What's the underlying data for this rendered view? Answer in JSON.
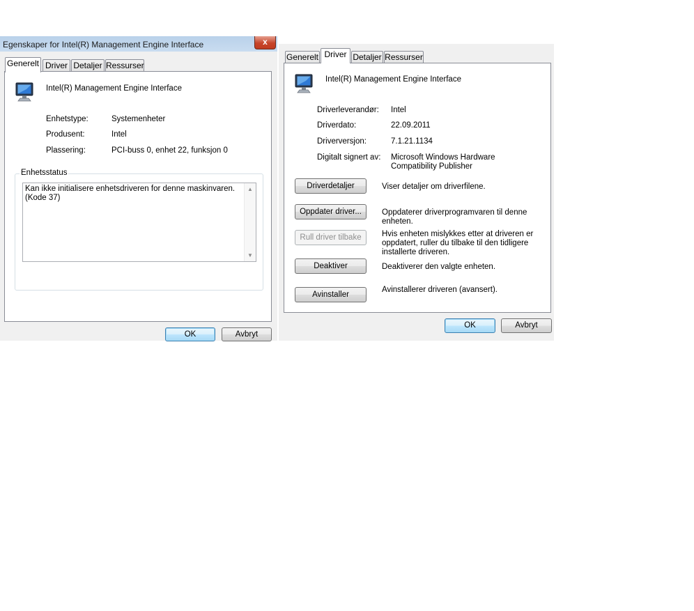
{
  "left_dialog": {
    "title": "Egenskaper for Intel(R) Management Engine Interface",
    "close_glyph": "x",
    "tabs": [
      {
        "label": "Generelt",
        "active": true
      },
      {
        "label": "Driver",
        "active": false
      },
      {
        "label": "Detaljer",
        "active": false
      },
      {
        "label": "Ressurser",
        "active": false
      }
    ],
    "device_name": "Intel(R) Management Engine Interface",
    "device_icon": "monitor-icon",
    "properties": [
      {
        "label": "Enhetstype:",
        "value": "Systemenheter"
      },
      {
        "label": "Produsent:",
        "value": "Intel"
      },
      {
        "label": "Plassering:",
        "value": "PCI-buss 0, enhet 22, funksjon 0"
      }
    ],
    "status_group": {
      "legend": "Enhetsstatus",
      "text": "Kan ikke initialisere enhetsdriveren for denne maskinvaren. (Kode 37)"
    },
    "ok_label": "OK",
    "cancel_label": "Avbryt"
  },
  "right_dialog": {
    "tabs": [
      {
        "label": "Generelt",
        "active": false
      },
      {
        "label": "Driver",
        "active": true
      },
      {
        "label": "Detaljer",
        "active": false
      },
      {
        "label": "Ressurser",
        "active": false
      }
    ],
    "device_name": "Intel(R) Management Engine Interface",
    "device_icon": "monitor-icon",
    "driver_info": [
      {
        "label": "Driverleverandør:",
        "value": "Intel"
      },
      {
        "label": "Driverdato:",
        "value": "22.09.2011"
      },
      {
        "label": "Driverversjon:",
        "value": "7.1.21.1134"
      },
      {
        "label": "Digitalt signert av:",
        "value": "Microsoft Windows Hardware Compatibility Publisher"
      }
    ],
    "actions": [
      {
        "label": "Driverdetaljer",
        "description": "Viser detaljer om driverfilene.",
        "enabled": true
      },
      {
        "label": "Oppdater driver...",
        "description": "Oppdaterer driverprogramvaren til denne enheten.",
        "enabled": true
      },
      {
        "label": "Rull driver tilbake",
        "description": "Hvis enheten mislykkes etter at driveren er oppdatert, ruller du tilbake til den tidligere installerte driveren.",
        "enabled": false
      },
      {
        "label": "Deaktiver",
        "description": "Deaktiverer den valgte enheten.",
        "enabled": true
      },
      {
        "label": "Avinstaller",
        "description": "Avinstallerer driveren (avansert).",
        "enabled": true
      }
    ],
    "ok_label": "OK",
    "cancel_label": "Avbryt"
  },
  "colors": {
    "dialog_bg": "#f0f0f0",
    "content_bg": "#ffffff",
    "border": "#898c95",
    "close_button": "#c7452a",
    "default_button": "#3c7fb1"
  }
}
